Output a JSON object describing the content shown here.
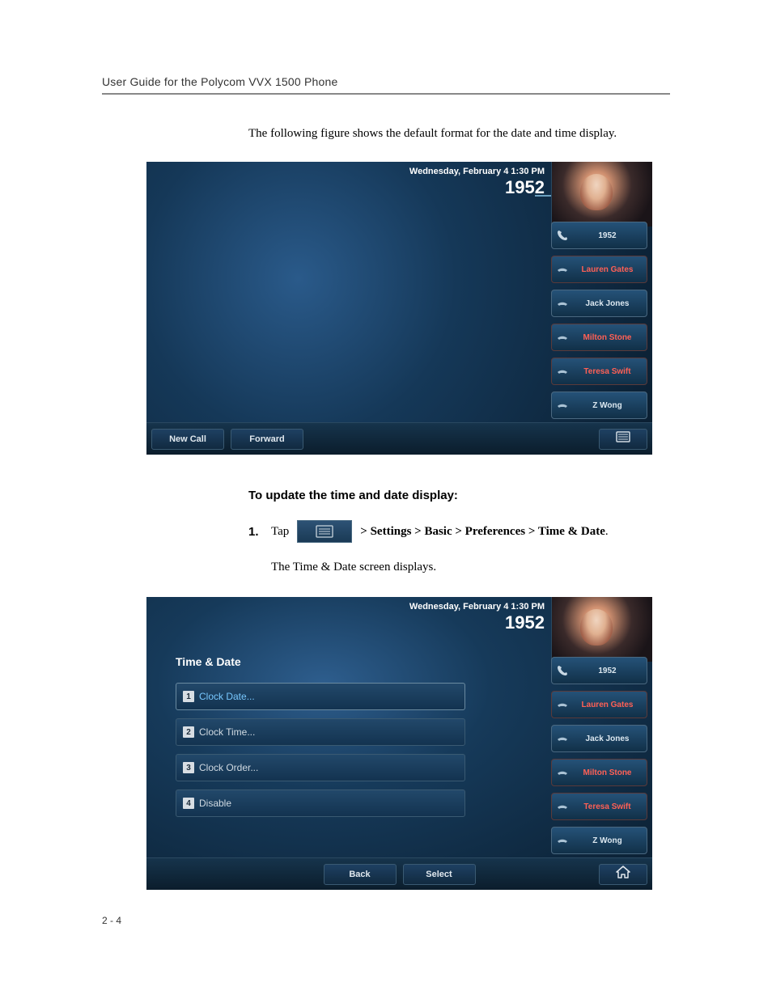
{
  "header": {
    "title": "User Guide for the Polycom VVX 1500 Phone"
  },
  "intro": "The following figure shows the default format for the date and time display.",
  "screen1": {
    "date_line": "Wednesday, February 4  1:30 PM",
    "extension": "1952",
    "speed_dials": [
      {
        "label": "1952",
        "type": "handset"
      },
      {
        "label": "Lauren Gates",
        "type": "busy"
      },
      {
        "label": "Jack Jones",
        "type": "busy"
      },
      {
        "label": "Milton Stone",
        "type": "busy"
      },
      {
        "label": "Teresa Swift",
        "type": "busy"
      },
      {
        "label": "Z Wong",
        "type": "busy"
      }
    ],
    "softkeys": {
      "new_call": "New Call",
      "forward": "Forward"
    }
  },
  "instruction_heading": "To update the time and date display:",
  "step1": {
    "num": "1.",
    "tap": "Tap",
    "path": " > Settings > Basic > Preferences > Time & Date",
    "period": ".",
    "followup": "The Time & Date screen displays."
  },
  "screen2": {
    "date_line": "Wednesday, February 4  1:30 PM",
    "extension": "1952",
    "menu_title": "Time & Date",
    "items": [
      {
        "num": "1",
        "label": "Clock Date..."
      },
      {
        "num": "2",
        "label": "Clock Time..."
      },
      {
        "num": "3",
        "label": "Clock Order..."
      },
      {
        "num": "4",
        "label": "Disable"
      }
    ],
    "speed_dials": [
      {
        "label": "1952",
        "type": "handset"
      },
      {
        "label": "Lauren Gates",
        "type": "busy"
      },
      {
        "label": "Jack Jones",
        "type": "busy"
      },
      {
        "label": "Milton Stone",
        "type": "busy"
      },
      {
        "label": "Teresa Swift",
        "type": "busy"
      },
      {
        "label": "Z Wong",
        "type": "busy"
      }
    ],
    "softkeys": {
      "back": "Back",
      "select": "Select"
    }
  },
  "page_num": "2 - 4"
}
